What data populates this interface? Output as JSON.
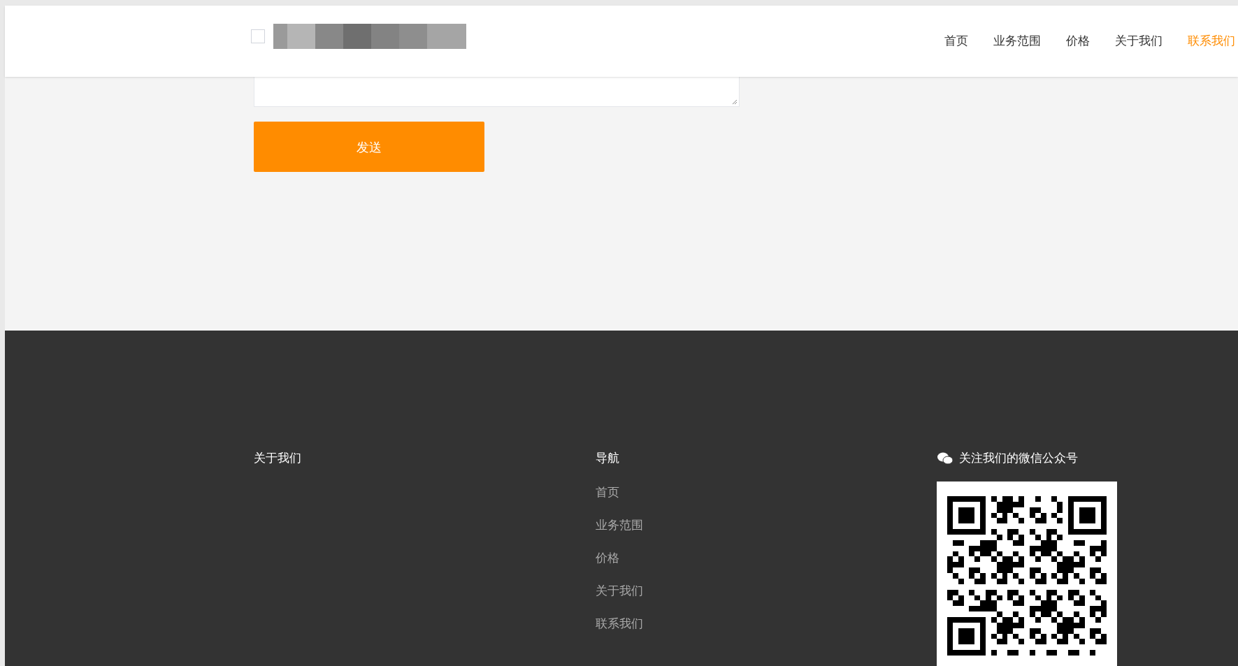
{
  "nav": [
    {
      "label": "首页",
      "selected": false
    },
    {
      "label": "业务范围",
      "selected": false
    },
    {
      "label": "价格",
      "selected": false
    },
    {
      "label": "关于我们",
      "selected": false
    },
    {
      "label": "联系我们",
      "selected": true
    }
  ],
  "form": {
    "send_button": "发送"
  },
  "footer": {
    "about": {
      "title": "关于我们"
    },
    "navigation": {
      "title": "导航",
      "links": [
        "首页",
        "业务范围",
        "价格",
        "关于我们",
        "联系我们"
      ]
    },
    "wechat": {
      "title": "关注我们的微信公众号"
    }
  }
}
